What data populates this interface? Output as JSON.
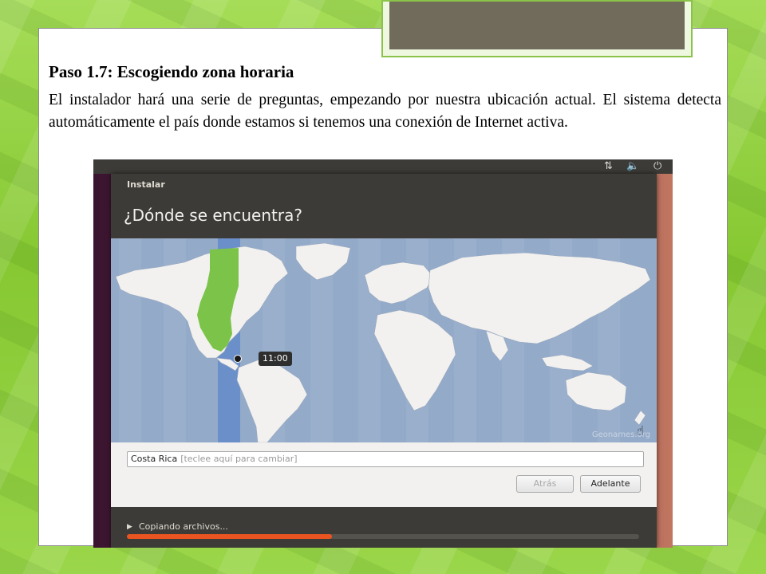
{
  "slide": {
    "heading": "Paso 1.7: Escogiendo zona horaria",
    "paragraph": "El instalador hará una serie de preguntas, empezando por nuestra ubicación actual. El sistema detecta automáticamente el país donde estamos si tenemos una conexión de Internet activa."
  },
  "installer": {
    "window_title": "Instalar",
    "question": "¿Dónde se encuentra?",
    "map_credit": "Geonames.org",
    "timezone_time": "11:00",
    "location_value": "Costa Rica",
    "location_hint": "[teclee aquí para cambiar]",
    "back_button": "Atrás",
    "next_button": "Adelante",
    "progress_label": "Copiando archivos...",
    "progress_fraction": 0.4
  },
  "topbar_icons": [
    "network-icon",
    "volume-icon",
    "power-icon"
  ],
  "colors": {
    "accent": "#e95420",
    "selected_region": "#7cc34a",
    "timezone_band": "#6b8fc9",
    "map_water": "#93aac9",
    "land": "#f2f1ef",
    "background_green": "#8fcf3a"
  }
}
